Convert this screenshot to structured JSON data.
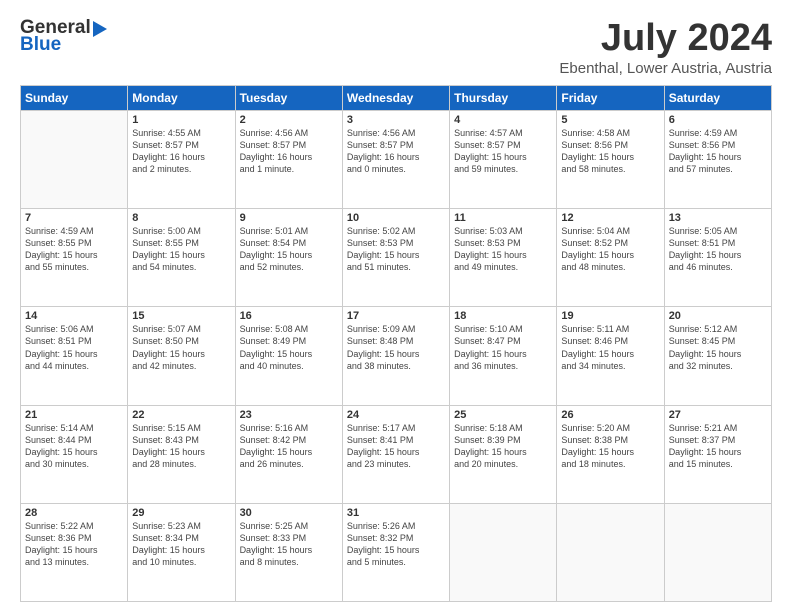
{
  "header": {
    "logo_general": "General",
    "logo_blue": "Blue",
    "main_title": "July 2024",
    "subtitle": "Ebenthal, Lower Austria, Austria"
  },
  "weekdays": [
    "Sunday",
    "Monday",
    "Tuesday",
    "Wednesday",
    "Thursday",
    "Friday",
    "Saturday"
  ],
  "weeks": [
    [
      {
        "day": "",
        "info": ""
      },
      {
        "day": "1",
        "info": "Sunrise: 4:55 AM\nSunset: 8:57 PM\nDaylight: 16 hours\nand 2 minutes."
      },
      {
        "day": "2",
        "info": "Sunrise: 4:56 AM\nSunset: 8:57 PM\nDaylight: 16 hours\nand 1 minute."
      },
      {
        "day": "3",
        "info": "Sunrise: 4:56 AM\nSunset: 8:57 PM\nDaylight: 16 hours\nand 0 minutes."
      },
      {
        "day": "4",
        "info": "Sunrise: 4:57 AM\nSunset: 8:57 PM\nDaylight: 15 hours\nand 59 minutes."
      },
      {
        "day": "5",
        "info": "Sunrise: 4:58 AM\nSunset: 8:56 PM\nDaylight: 15 hours\nand 58 minutes."
      },
      {
        "day": "6",
        "info": "Sunrise: 4:59 AM\nSunset: 8:56 PM\nDaylight: 15 hours\nand 57 minutes."
      }
    ],
    [
      {
        "day": "7",
        "info": "Sunrise: 4:59 AM\nSunset: 8:55 PM\nDaylight: 15 hours\nand 55 minutes."
      },
      {
        "day": "8",
        "info": "Sunrise: 5:00 AM\nSunset: 8:55 PM\nDaylight: 15 hours\nand 54 minutes."
      },
      {
        "day": "9",
        "info": "Sunrise: 5:01 AM\nSunset: 8:54 PM\nDaylight: 15 hours\nand 52 minutes."
      },
      {
        "day": "10",
        "info": "Sunrise: 5:02 AM\nSunset: 8:53 PM\nDaylight: 15 hours\nand 51 minutes."
      },
      {
        "day": "11",
        "info": "Sunrise: 5:03 AM\nSunset: 8:53 PM\nDaylight: 15 hours\nand 49 minutes."
      },
      {
        "day": "12",
        "info": "Sunrise: 5:04 AM\nSunset: 8:52 PM\nDaylight: 15 hours\nand 48 minutes."
      },
      {
        "day": "13",
        "info": "Sunrise: 5:05 AM\nSunset: 8:51 PM\nDaylight: 15 hours\nand 46 minutes."
      }
    ],
    [
      {
        "day": "14",
        "info": "Sunrise: 5:06 AM\nSunset: 8:51 PM\nDaylight: 15 hours\nand 44 minutes."
      },
      {
        "day": "15",
        "info": "Sunrise: 5:07 AM\nSunset: 8:50 PM\nDaylight: 15 hours\nand 42 minutes."
      },
      {
        "day": "16",
        "info": "Sunrise: 5:08 AM\nSunset: 8:49 PM\nDaylight: 15 hours\nand 40 minutes."
      },
      {
        "day": "17",
        "info": "Sunrise: 5:09 AM\nSunset: 8:48 PM\nDaylight: 15 hours\nand 38 minutes."
      },
      {
        "day": "18",
        "info": "Sunrise: 5:10 AM\nSunset: 8:47 PM\nDaylight: 15 hours\nand 36 minutes."
      },
      {
        "day": "19",
        "info": "Sunrise: 5:11 AM\nSunset: 8:46 PM\nDaylight: 15 hours\nand 34 minutes."
      },
      {
        "day": "20",
        "info": "Sunrise: 5:12 AM\nSunset: 8:45 PM\nDaylight: 15 hours\nand 32 minutes."
      }
    ],
    [
      {
        "day": "21",
        "info": "Sunrise: 5:14 AM\nSunset: 8:44 PM\nDaylight: 15 hours\nand 30 minutes."
      },
      {
        "day": "22",
        "info": "Sunrise: 5:15 AM\nSunset: 8:43 PM\nDaylight: 15 hours\nand 28 minutes."
      },
      {
        "day": "23",
        "info": "Sunrise: 5:16 AM\nSunset: 8:42 PM\nDaylight: 15 hours\nand 26 minutes."
      },
      {
        "day": "24",
        "info": "Sunrise: 5:17 AM\nSunset: 8:41 PM\nDaylight: 15 hours\nand 23 minutes."
      },
      {
        "day": "25",
        "info": "Sunrise: 5:18 AM\nSunset: 8:39 PM\nDaylight: 15 hours\nand 20 minutes."
      },
      {
        "day": "26",
        "info": "Sunrise: 5:20 AM\nSunset: 8:38 PM\nDaylight: 15 hours\nand 18 minutes."
      },
      {
        "day": "27",
        "info": "Sunrise: 5:21 AM\nSunset: 8:37 PM\nDaylight: 15 hours\nand 15 minutes."
      }
    ],
    [
      {
        "day": "28",
        "info": "Sunrise: 5:22 AM\nSunset: 8:36 PM\nDaylight: 15 hours\nand 13 minutes."
      },
      {
        "day": "29",
        "info": "Sunrise: 5:23 AM\nSunset: 8:34 PM\nDaylight: 15 hours\nand 10 minutes."
      },
      {
        "day": "30",
        "info": "Sunrise: 5:25 AM\nSunset: 8:33 PM\nDaylight: 15 hours\nand 8 minutes."
      },
      {
        "day": "31",
        "info": "Sunrise: 5:26 AM\nSunset: 8:32 PM\nDaylight: 15 hours\nand 5 minutes."
      },
      {
        "day": "",
        "info": ""
      },
      {
        "day": "",
        "info": ""
      },
      {
        "day": "",
        "info": ""
      }
    ]
  ]
}
